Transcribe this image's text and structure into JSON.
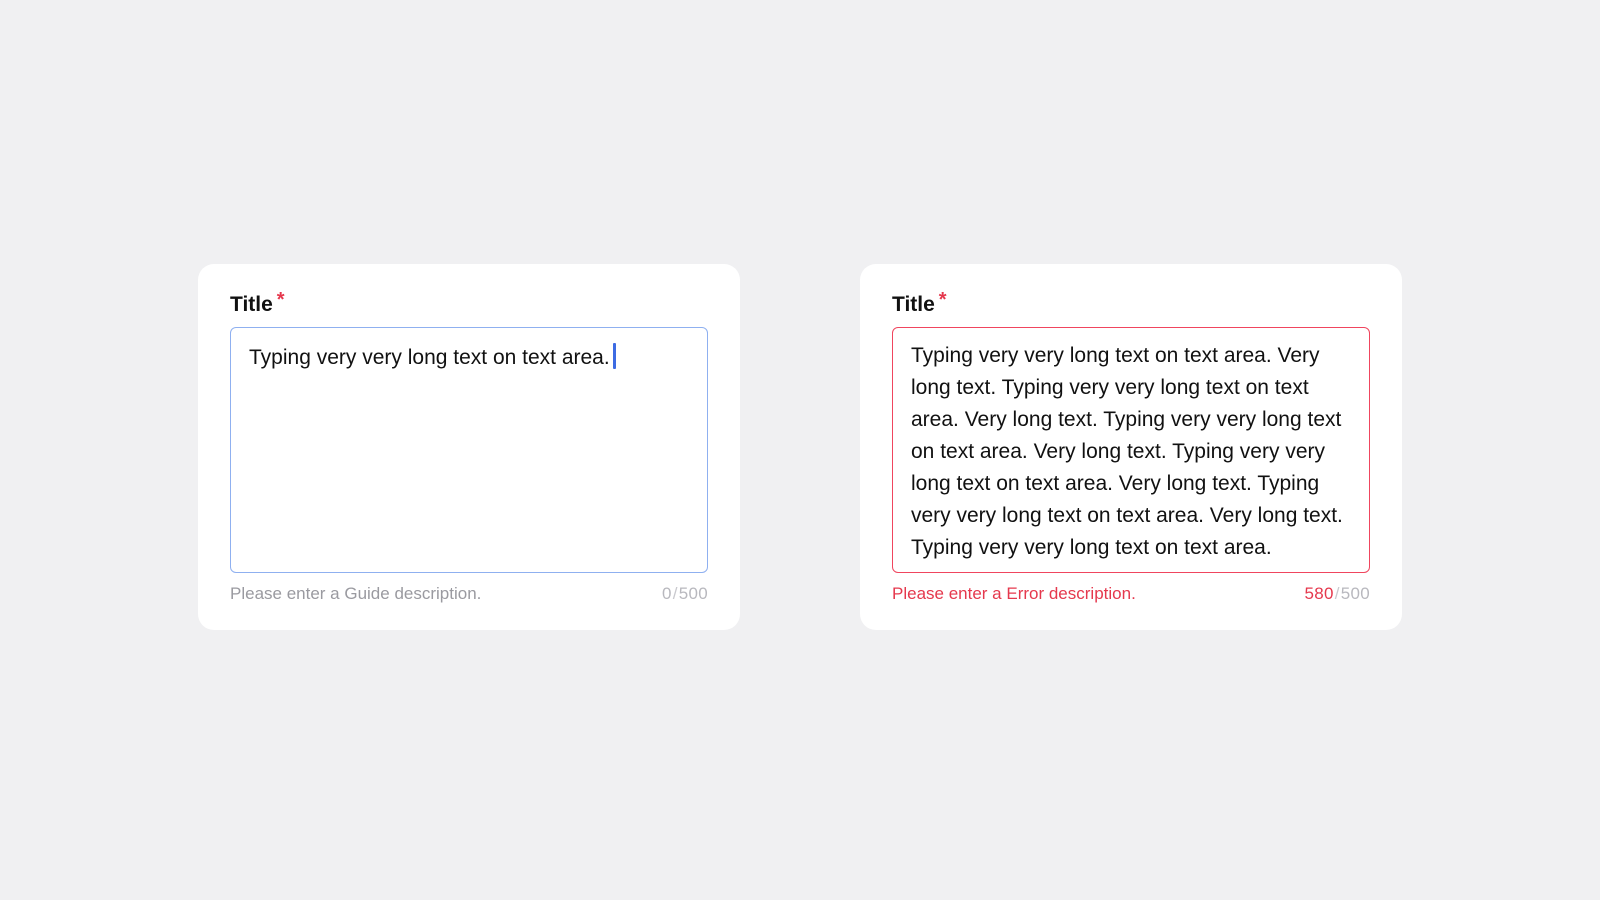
{
  "left_field": {
    "label": "Title",
    "required_mark": "*",
    "value": "Typing very very long text on text area.",
    "helper": "Please enter a Guide description.",
    "count": "0",
    "separator": "/",
    "max": "500",
    "state": "focused",
    "border_color": "#8fb0f0"
  },
  "right_field": {
    "label": "Title",
    "required_mark": "*",
    "value": "Typing very very long text on text area. Very long text. Typing very very long text on text area. Very long text. Typing very very long text on text area. Very long text. Typing very very long text on text area. Very long text. Typing very very long text on text area. Very long text. Typing very very long text on text area.",
    "helper": "Please enter a Error description.",
    "count": "580",
    "separator": "/",
    "max": "500",
    "state": "error",
    "border_color": "#f0455e"
  },
  "colors": {
    "background": "#f0f0f2",
    "card": "#ffffff",
    "required": "#e5384d",
    "error": "#e5384d",
    "caret": "#3d6be3",
    "helper": "#9a9aa0"
  }
}
